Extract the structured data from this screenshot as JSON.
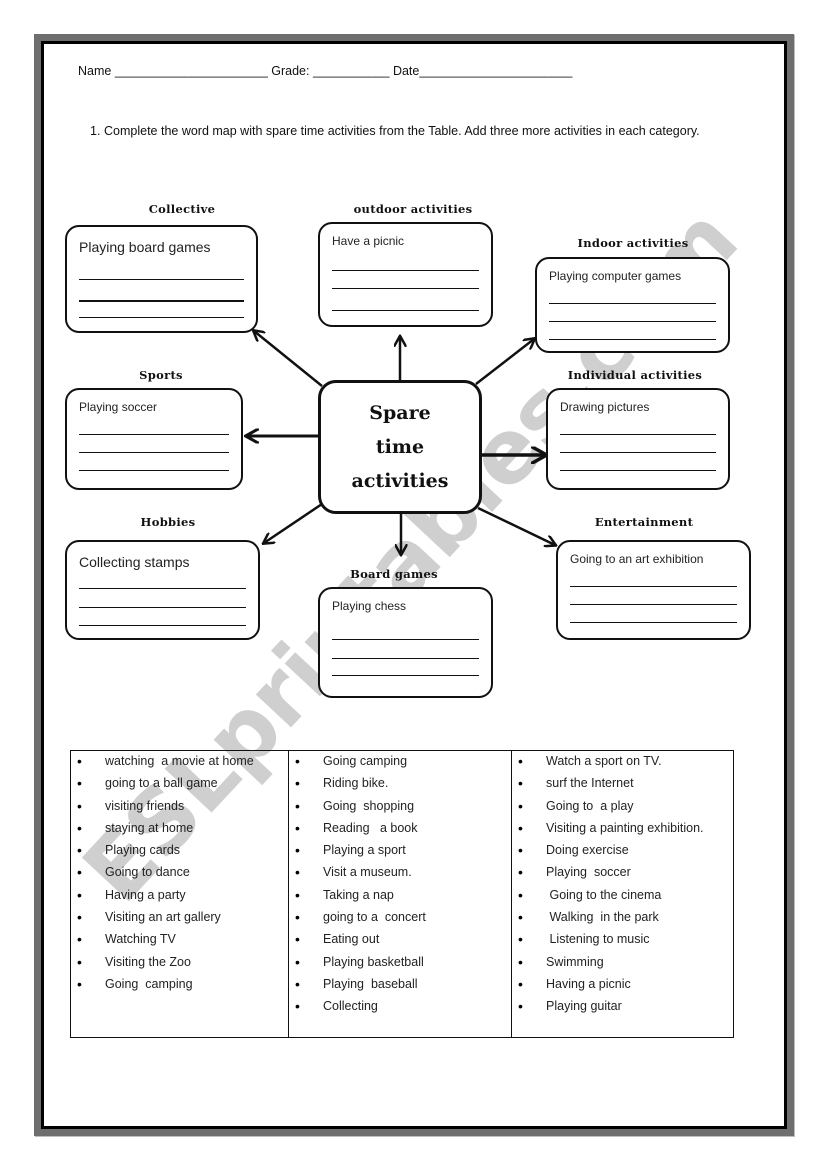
{
  "header": {
    "name_label": "Name",
    "name_blank": "______________________",
    "grade_label": "Grade:",
    "grade_blank": "___________",
    "date_label": "Date",
    "date_blank": "______________________"
  },
  "instruction": {
    "number": "1.",
    "text": "Complete the word map with spare time activities from the Table. Add three more activities in each category."
  },
  "word_map": {
    "center": [
      "Spare",
      "time",
      "activities"
    ],
    "categories": {
      "collective": {
        "title": "Collective",
        "example": "Playing board games",
        "blank_lines": 3
      },
      "outdoor": {
        "title": "outdoor activities",
        "example": "Have a picnic",
        "blank_lines": 3
      },
      "indoor": {
        "title": "Indoor activities",
        "example": "Playing computer games",
        "blank_lines": 3
      },
      "sports": {
        "title": "Sports",
        "example": "Playing soccer",
        "blank_lines": 3
      },
      "individual": {
        "title": "Individual activities",
        "example": "Drawing pictures",
        "blank_lines": 3
      },
      "hobbies": {
        "title": "Hobbies",
        "example": "Collecting stamps",
        "blank_lines": 3
      },
      "board_games": {
        "title": "Board games",
        "example": "Playing chess",
        "blank_lines": 3
      },
      "entertainment": {
        "title": "Entertainment",
        "example": "Going to an art exhibition",
        "blank_lines": 3
      }
    }
  },
  "activity_table": {
    "columns": [
      [
        "watching  a movie at home",
        "going to a ball game",
        "visiting friends",
        "staying at home",
        "Playing cards",
        "Going to dance",
        "Having a party",
        "Visiting an art gallery",
        "Watching TV",
        "Visiting the Zoo",
        "Going  camping"
      ],
      [
        "Going camping",
        "Riding bike.",
        "Going  shopping",
        "Reading   a book",
        "Playing a sport",
        "Visit a museum.",
        "Taking a nap",
        "going to a  concert",
        "Eating out",
        "Playing basketball",
        "Playing  baseball",
        "Collecting"
      ],
      [
        "Watch a sport on TV.",
        "surf the Internet",
        "Going to  a play",
        "Visiting a painting exhibition.",
        "Doing exercise",
        "Playing  soccer",
        " Going to the cinema",
        " Walking  in the park",
        " Listening to music",
        "Swimming",
        "Having a picnic",
        "Playing guitar"
      ]
    ]
  },
  "watermark": "ESLprintables.com",
  "colors": {
    "ink": "#111111",
    "frame_gray": "#6e6e6e",
    "watermark_gray": "#c7c7c7"
  }
}
